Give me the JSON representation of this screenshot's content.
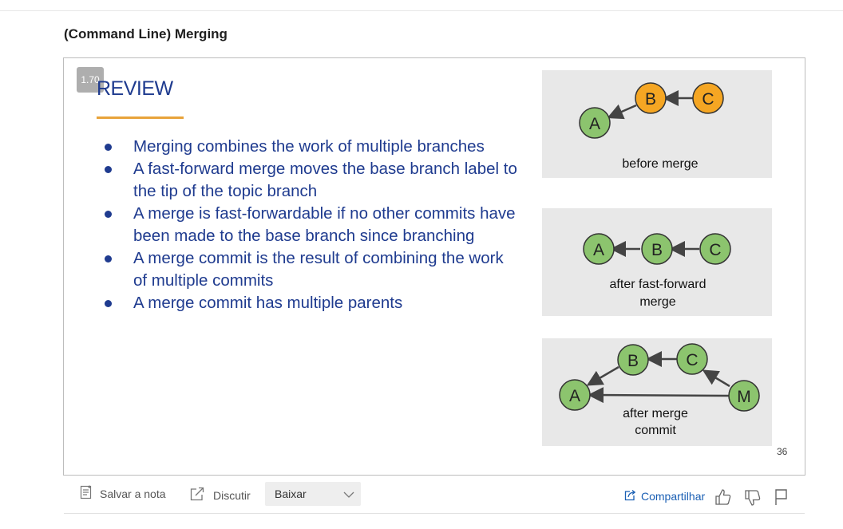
{
  "page": {
    "title": "(Command Line) Merging"
  },
  "slide": {
    "speed": "1.70",
    "heading": "REVIEW",
    "bullets": [
      "Merging combines the work of multiple branches",
      "A fast-forward merge moves the base branch label to the tip of the topic branch",
      "A merge is fast-forwardable if no other commits have been made to the base branch since branching",
      "A merge commit is the result of combining the work of multiple commits",
      "A merge commit has multiple parents"
    ],
    "slide_number": "36",
    "diagrams": {
      "before": {
        "caption": "before merge",
        "nodes": [
          "A",
          "B",
          "C"
        ]
      },
      "fast_forward": {
        "caption_line1": "after fast-forward",
        "caption_line2": "merge",
        "nodes": [
          "A",
          "B",
          "C"
        ]
      },
      "merge_commit": {
        "caption_line1": "after merge",
        "caption_line2": "commit",
        "nodes": [
          "A",
          "B",
          "C",
          "M"
        ]
      }
    },
    "colors": {
      "heading": "#1f3b8f",
      "accent_rule": "#e8a33a",
      "node_orange": "#f5a623",
      "node_green": "#8cc46e"
    }
  },
  "toolbar": {
    "save_note": "Salvar a nota",
    "discuss": "Discutir",
    "download_select": "Baixar",
    "share": "Compartilhar"
  },
  "icons": [
    "note-icon",
    "discuss-icon",
    "chevron-down-icon",
    "share-icon",
    "thumbs-up-icon",
    "thumbs-down-icon",
    "flag-icon"
  ]
}
